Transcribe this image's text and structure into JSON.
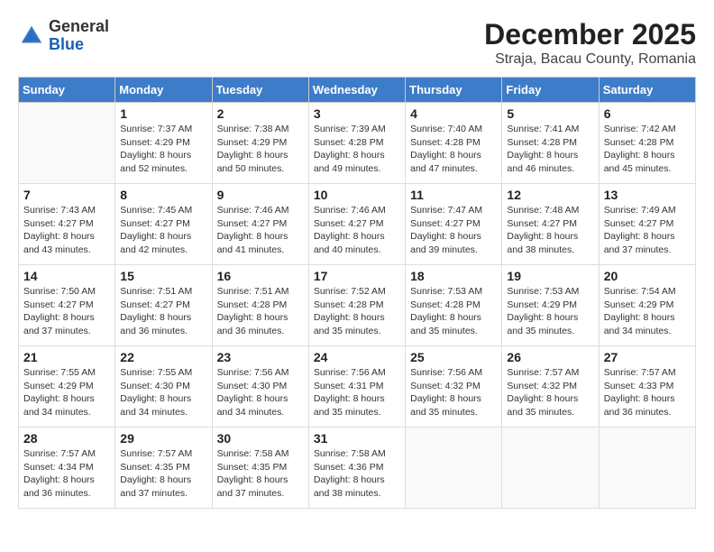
{
  "header": {
    "logo_line1": "General",
    "logo_line2": "Blue",
    "month_title": "December 2025",
    "location": "Straja, Bacau County, Romania"
  },
  "days_of_week": [
    "Sunday",
    "Monday",
    "Tuesday",
    "Wednesday",
    "Thursday",
    "Friday",
    "Saturday"
  ],
  "weeks": [
    [
      {
        "day": "",
        "info": ""
      },
      {
        "day": "1",
        "info": "Sunrise: 7:37 AM\nSunset: 4:29 PM\nDaylight: 8 hours\nand 52 minutes."
      },
      {
        "day": "2",
        "info": "Sunrise: 7:38 AM\nSunset: 4:29 PM\nDaylight: 8 hours\nand 50 minutes."
      },
      {
        "day": "3",
        "info": "Sunrise: 7:39 AM\nSunset: 4:28 PM\nDaylight: 8 hours\nand 49 minutes."
      },
      {
        "day": "4",
        "info": "Sunrise: 7:40 AM\nSunset: 4:28 PM\nDaylight: 8 hours\nand 47 minutes."
      },
      {
        "day": "5",
        "info": "Sunrise: 7:41 AM\nSunset: 4:28 PM\nDaylight: 8 hours\nand 46 minutes."
      },
      {
        "day": "6",
        "info": "Sunrise: 7:42 AM\nSunset: 4:28 PM\nDaylight: 8 hours\nand 45 minutes."
      }
    ],
    [
      {
        "day": "7",
        "info": "Sunrise: 7:43 AM\nSunset: 4:27 PM\nDaylight: 8 hours\nand 43 minutes."
      },
      {
        "day": "8",
        "info": "Sunrise: 7:45 AM\nSunset: 4:27 PM\nDaylight: 8 hours\nand 42 minutes."
      },
      {
        "day": "9",
        "info": "Sunrise: 7:46 AM\nSunset: 4:27 PM\nDaylight: 8 hours\nand 41 minutes."
      },
      {
        "day": "10",
        "info": "Sunrise: 7:46 AM\nSunset: 4:27 PM\nDaylight: 8 hours\nand 40 minutes."
      },
      {
        "day": "11",
        "info": "Sunrise: 7:47 AM\nSunset: 4:27 PM\nDaylight: 8 hours\nand 39 minutes."
      },
      {
        "day": "12",
        "info": "Sunrise: 7:48 AM\nSunset: 4:27 PM\nDaylight: 8 hours\nand 38 minutes."
      },
      {
        "day": "13",
        "info": "Sunrise: 7:49 AM\nSunset: 4:27 PM\nDaylight: 8 hours\nand 37 minutes."
      }
    ],
    [
      {
        "day": "14",
        "info": "Sunrise: 7:50 AM\nSunset: 4:27 PM\nDaylight: 8 hours\nand 37 minutes."
      },
      {
        "day": "15",
        "info": "Sunrise: 7:51 AM\nSunset: 4:27 PM\nDaylight: 8 hours\nand 36 minutes."
      },
      {
        "day": "16",
        "info": "Sunrise: 7:51 AM\nSunset: 4:28 PM\nDaylight: 8 hours\nand 36 minutes."
      },
      {
        "day": "17",
        "info": "Sunrise: 7:52 AM\nSunset: 4:28 PM\nDaylight: 8 hours\nand 35 minutes."
      },
      {
        "day": "18",
        "info": "Sunrise: 7:53 AM\nSunset: 4:28 PM\nDaylight: 8 hours\nand 35 minutes."
      },
      {
        "day": "19",
        "info": "Sunrise: 7:53 AM\nSunset: 4:29 PM\nDaylight: 8 hours\nand 35 minutes."
      },
      {
        "day": "20",
        "info": "Sunrise: 7:54 AM\nSunset: 4:29 PM\nDaylight: 8 hours\nand 34 minutes."
      }
    ],
    [
      {
        "day": "21",
        "info": "Sunrise: 7:55 AM\nSunset: 4:29 PM\nDaylight: 8 hours\nand 34 minutes."
      },
      {
        "day": "22",
        "info": "Sunrise: 7:55 AM\nSunset: 4:30 PM\nDaylight: 8 hours\nand 34 minutes."
      },
      {
        "day": "23",
        "info": "Sunrise: 7:56 AM\nSunset: 4:30 PM\nDaylight: 8 hours\nand 34 minutes."
      },
      {
        "day": "24",
        "info": "Sunrise: 7:56 AM\nSunset: 4:31 PM\nDaylight: 8 hours\nand 35 minutes."
      },
      {
        "day": "25",
        "info": "Sunrise: 7:56 AM\nSunset: 4:32 PM\nDaylight: 8 hours\nand 35 minutes."
      },
      {
        "day": "26",
        "info": "Sunrise: 7:57 AM\nSunset: 4:32 PM\nDaylight: 8 hours\nand 35 minutes."
      },
      {
        "day": "27",
        "info": "Sunrise: 7:57 AM\nSunset: 4:33 PM\nDaylight: 8 hours\nand 36 minutes."
      }
    ],
    [
      {
        "day": "28",
        "info": "Sunrise: 7:57 AM\nSunset: 4:34 PM\nDaylight: 8 hours\nand 36 minutes."
      },
      {
        "day": "29",
        "info": "Sunrise: 7:57 AM\nSunset: 4:35 PM\nDaylight: 8 hours\nand 37 minutes."
      },
      {
        "day": "30",
        "info": "Sunrise: 7:58 AM\nSunset: 4:35 PM\nDaylight: 8 hours\nand 37 minutes."
      },
      {
        "day": "31",
        "info": "Sunrise: 7:58 AM\nSunset: 4:36 PM\nDaylight: 8 hours\nand 38 minutes."
      },
      {
        "day": "",
        "info": ""
      },
      {
        "day": "",
        "info": ""
      },
      {
        "day": "",
        "info": ""
      }
    ]
  ]
}
